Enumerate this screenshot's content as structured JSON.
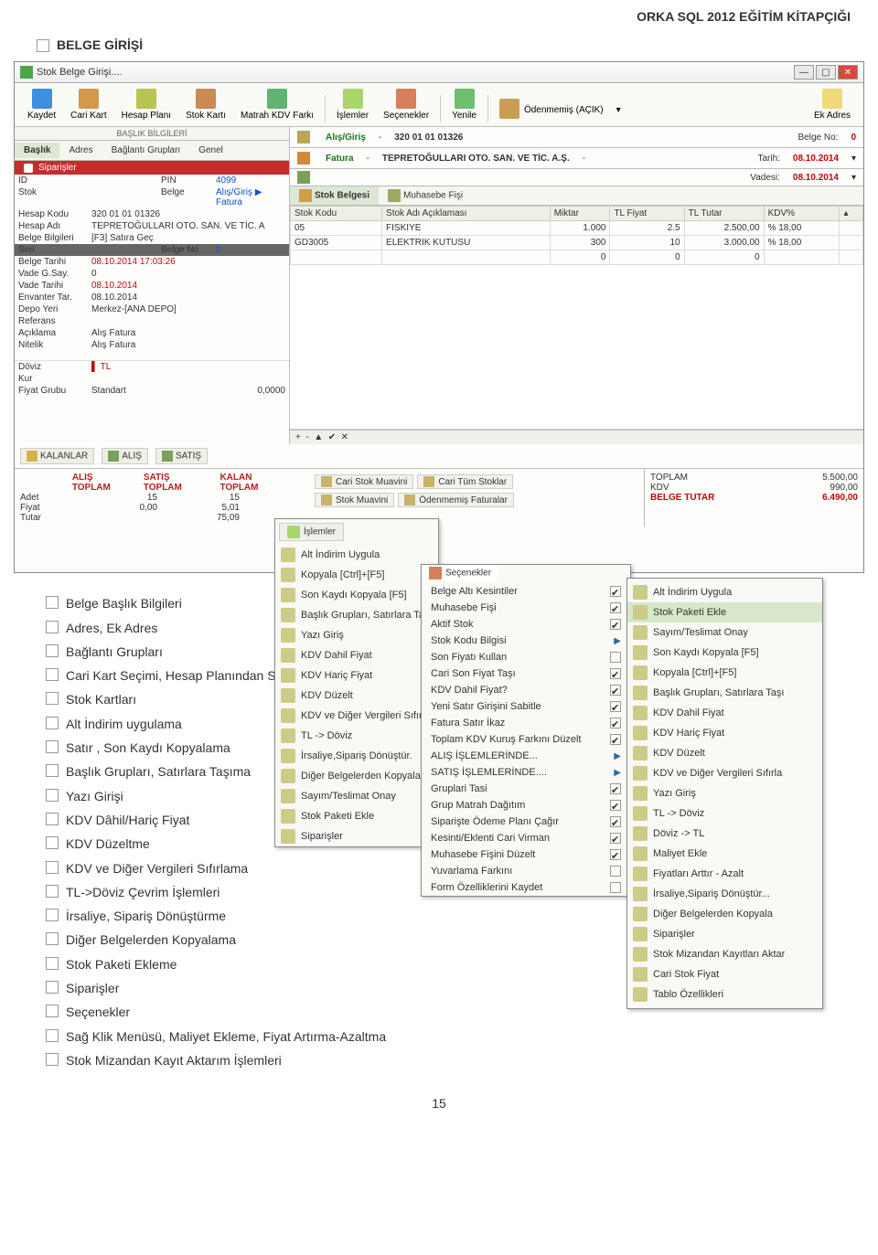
{
  "doc": {
    "header": "ORKA SQL 2012 EĞİTİM KİTAPÇIĞI",
    "section": "BELGE GİRİŞİ",
    "page_number": "15",
    "bullets": [
      "Belge Başlık Bilgileri",
      "Adres, Ek Adres",
      "Bağlantı Grupları",
      "Cari Kart Seçimi, Hesap Planından Seçim",
      "Stok Kartları",
      "Alt İndirim uygulama",
      "Satır , Son Kaydı Kopyalama",
      "Başlık Grupları, Satırlara Taşıma",
      "Yazı Girişi",
      "KDV Dâhil/Hariç Fiyat",
      "KDV Düzeltme",
      "KDV ve Diğer Vergileri Sıfırlama",
      "TL->Döviz Çevrim İşlemleri",
      "İrsaliye, Sipariş Dönüştürme",
      "Diğer Belgelerden Kopyalama",
      "Stok Paketi Ekleme",
      "Siparişler",
      "Seçenekler",
      "Sağ Klik Menüsü, Maliyet Ekleme, Fiyat Artırma-Azaltma",
      "Stok Mizandan Kayıt Aktarım İşlemleri"
    ]
  },
  "window": {
    "title": "Stok Belge Girişi....",
    "toolbar": [
      "Kaydet",
      "Cari Kart",
      "Hesap Planı",
      "Stok Kartı",
      "Matrah KDV Farkı",
      "İşlemler",
      "Seçenekler",
      "Yenile",
      "Ödenmemiş (AÇIK)",
      "Ek Adres"
    ],
    "tabs_upper": "BAŞLIK BİLGİLERİ",
    "tabs_left": [
      "Başlık",
      "Adres",
      "Bağlantı Grupları",
      "Genel"
    ],
    "orders_tab": "Siparişler",
    "header_right": {
      "l1a": "Alış/Giriş",
      "l1b": "320 01 01 01326",
      "l2a": "Fatura",
      "l2b": "TEPRETOĞULLARI OTO. SAN. VE TİC. A.Ş.",
      "belge_no_lbl": "Belge No:",
      "belge_no_val": "0",
      "tarih_lbl": "Tarih:",
      "tarih_val": "08.10.2014",
      "vades_lbl": "Vadesi:",
      "vades_val": "08.10.2014"
    },
    "details": [
      {
        "k": "ID",
        "v": "",
        "k2": "PIN",
        "v2": "4099"
      },
      {
        "k": "Stok",
        "v": "",
        "k2": "Belge",
        "v2": "Alış/Giriş   ▶   Fatura"
      },
      {
        "k": "Hesap Kodu",
        "v": "320 01 01 01326"
      },
      {
        "k": "Hesap Adı",
        "v": "TEPRETOĞULLARI OTO. SAN. VE TİC. A"
      },
      {
        "k": "Belge Bilgileri",
        "v": "[F3] Satıra Geç"
      },
      {
        "k": "Seri",
        "v": "",
        "k2": "Belge No",
        "v2": "0",
        "dark": true
      },
      {
        "k": "Belge Tarihi",
        "v": "08.10.2014 17:03:26",
        "red": true
      },
      {
        "k": "Vade G.Say.",
        "v": "0"
      },
      {
        "k": "Vade Tarihi",
        "v": "08.10.2014",
        "red": true
      },
      {
        "k": "Envanter Tar.",
        "v": "08.10.2014"
      },
      {
        "k": "Depo Yeri",
        "v": "Merkez-[ANA DEPO]"
      },
      {
        "k": "Referans",
        "v": ""
      },
      {
        "k": "Açıklama",
        "v": "Alış Fatura"
      },
      {
        "k": "Nitelik",
        "v": "Alış Fatura"
      }
    ],
    "doviz_block": [
      {
        "k": "Döviz",
        "v": "TL",
        "red": true
      },
      {
        "k": "Kur",
        "v": ""
      },
      {
        "k": "Fiyat Grubu",
        "v": "Standart",
        "amount": "0,0000"
      }
    ],
    "stock_tabs": [
      "Stok Belgesi",
      "Muhasebe Fişi"
    ],
    "stock_cols": [
      "Stok Kodu",
      "Stok Adı Açıklaması",
      "Miktar",
      "TL Fiyat",
      "TL Tutar",
      "KDV%"
    ],
    "stock_rows": [
      {
        "kod": "05",
        "ad": "FISKIYE",
        "miktar": "1.000",
        "fiyat": "2.5",
        "tutar": "2.500,00",
        "kdv": "% 18,00"
      },
      {
        "kod": "GD3005",
        "ad": "ELEKTRIK KUTUSU",
        "miktar": "300",
        "fiyat": "10",
        "tutar": "3.000,00",
        "kdv": "% 18,00"
      },
      {
        "kod": "",
        "ad": "",
        "miktar": "0",
        "fiyat": "0",
        "tutar": "0",
        "kdv": ""
      }
    ],
    "bottom_tabs": [
      "KALANLAR",
      "ALIŞ",
      "SATIŞ"
    ],
    "summary_head": [
      "ALIŞ TOPLAM",
      "SATIŞ TOPLAM",
      "KALAN TOPLAM"
    ],
    "summary_rows": [
      {
        "lbl": "Adet",
        "a": "15",
        "b": "15"
      },
      {
        "lbl": "Fiyat",
        "a": "0,00",
        "b": "5,01"
      },
      {
        "lbl": "Tutar",
        "a": "",
        "b": "75,09"
      }
    ],
    "action_chips": [
      "Cari Stok Muavini",
      "Cari Tüm Stoklar",
      "Stok Muavini",
      "Ödenmemiş Faturalar"
    ],
    "totals": [
      {
        "k": "TOPLAM",
        "v": "5.500,00"
      },
      {
        "k": "KDV",
        "v": "990,00"
      },
      {
        "k": "BELGE TUTAR",
        "v": "6.490,00",
        "final": true
      }
    ]
  },
  "menus": {
    "islemler_btn": "İşlemler",
    "islemler": [
      {
        "t": "Alt İndirim Uygula"
      },
      {
        "t": "Kopyala [Ctrl]+[F5]"
      },
      {
        "t": "Son Kaydı Kopyala [F5]"
      },
      {
        "t": "Başlık Grupları, Satırlara Taşı"
      },
      {
        "t": "Yazı Giriş"
      },
      {
        "t": "KDV Dahil Fiyat"
      },
      {
        "t": "KDV Hariç Fiyat"
      },
      {
        "t": "KDV Düzelt"
      },
      {
        "t": "KDV ve Diğer Vergileri Sıfırla"
      },
      {
        "t": "TL -> Döviz"
      },
      {
        "t": "İrsaliye,Sipariş Dönüştür."
      },
      {
        "t": "Diğer Belgelerden Kopyala"
      },
      {
        "t": "Sayım/Teslimat Onay"
      },
      {
        "t": "Stok Paketi Ekle"
      },
      {
        "t": "Siparişler"
      }
    ],
    "secenekler_btn": "Seçenekler",
    "secenekler": [
      {
        "t": "Belge Altı Kesintiler",
        "c": true
      },
      {
        "t": "Muhasebe Fişi",
        "c": true
      },
      {
        "t": "Aktif Stok",
        "c": true
      },
      {
        "t": "Stok Kodu Bilgisi",
        "tri": true
      },
      {
        "t": "Son Fiyatı Kullan",
        "c": false
      },
      {
        "t": "Cari Son Fiyat Taşı",
        "c": true
      },
      {
        "t": "KDV Dahil Fiyat?",
        "c": true
      },
      {
        "t": "Yeni Satır Girişini Sabitle",
        "c": true
      },
      {
        "t": "Fatura Satır İkaz",
        "c": true
      },
      {
        "t": "Toplam KDV Kuruş Farkını Düzelt",
        "c": true
      },
      {
        "t": "ALIŞ İŞLEMLERİNDE...",
        "tri": true
      },
      {
        "t": "SATIŞ İŞLEMLERİNDE....",
        "tri": true
      },
      {
        "t": "Gruplari Tasi",
        "c": true
      },
      {
        "t": "Grup Matrah Dağıtım",
        "c": true
      },
      {
        "t": "Siparişte Ödeme Planı Çağır",
        "c": true
      },
      {
        "t": "Kesinti/Eklenti Cari Virman",
        "c": true
      },
      {
        "t": "Muhasebe Fişini Düzelt",
        "c": true
      },
      {
        "t": "Yuvarlama Farkını",
        "c": false,
        "info": true
      },
      {
        "t": "Form Özelliklerini Kaydet"
      }
    ],
    "context": [
      {
        "t": "Alt İndirim Uygula"
      },
      {
        "t": "Stok Paketi Ekle",
        "hl": true
      },
      {
        "t": "Sayım/Teslimat Onay"
      },
      {
        "t": "Son Kaydı Kopyala [F5]"
      },
      {
        "t": "Kopyala [Ctrl]+[F5]"
      },
      {
        "t": "Başlık Grupları, Satırlara Taşı"
      },
      {
        "t": "KDV Dahil Fiyat"
      },
      {
        "t": "KDV Hariç Fiyat"
      },
      {
        "t": "KDV Düzelt"
      },
      {
        "t": "KDV ve Diğer Vergileri Sıfırla"
      },
      {
        "t": "Yazı Giriş"
      },
      {
        "t": "TL -> Döviz"
      },
      {
        "t": "Döviz -> TL"
      },
      {
        "t": "Maliyet Ekle"
      },
      {
        "t": "Fiyatları Arttır - Azalt"
      },
      {
        "t": "İrsaliye,Sipariş Dönüştür..."
      },
      {
        "t": "Diğer Belgelerden Kopyala"
      },
      {
        "t": "Siparişler"
      },
      {
        "t": "Stok Mizandan Kayıtları Aktar"
      },
      {
        "t": "Cari Stok Fiyat"
      },
      {
        "t": "Tablo Özellikleri"
      }
    ]
  }
}
